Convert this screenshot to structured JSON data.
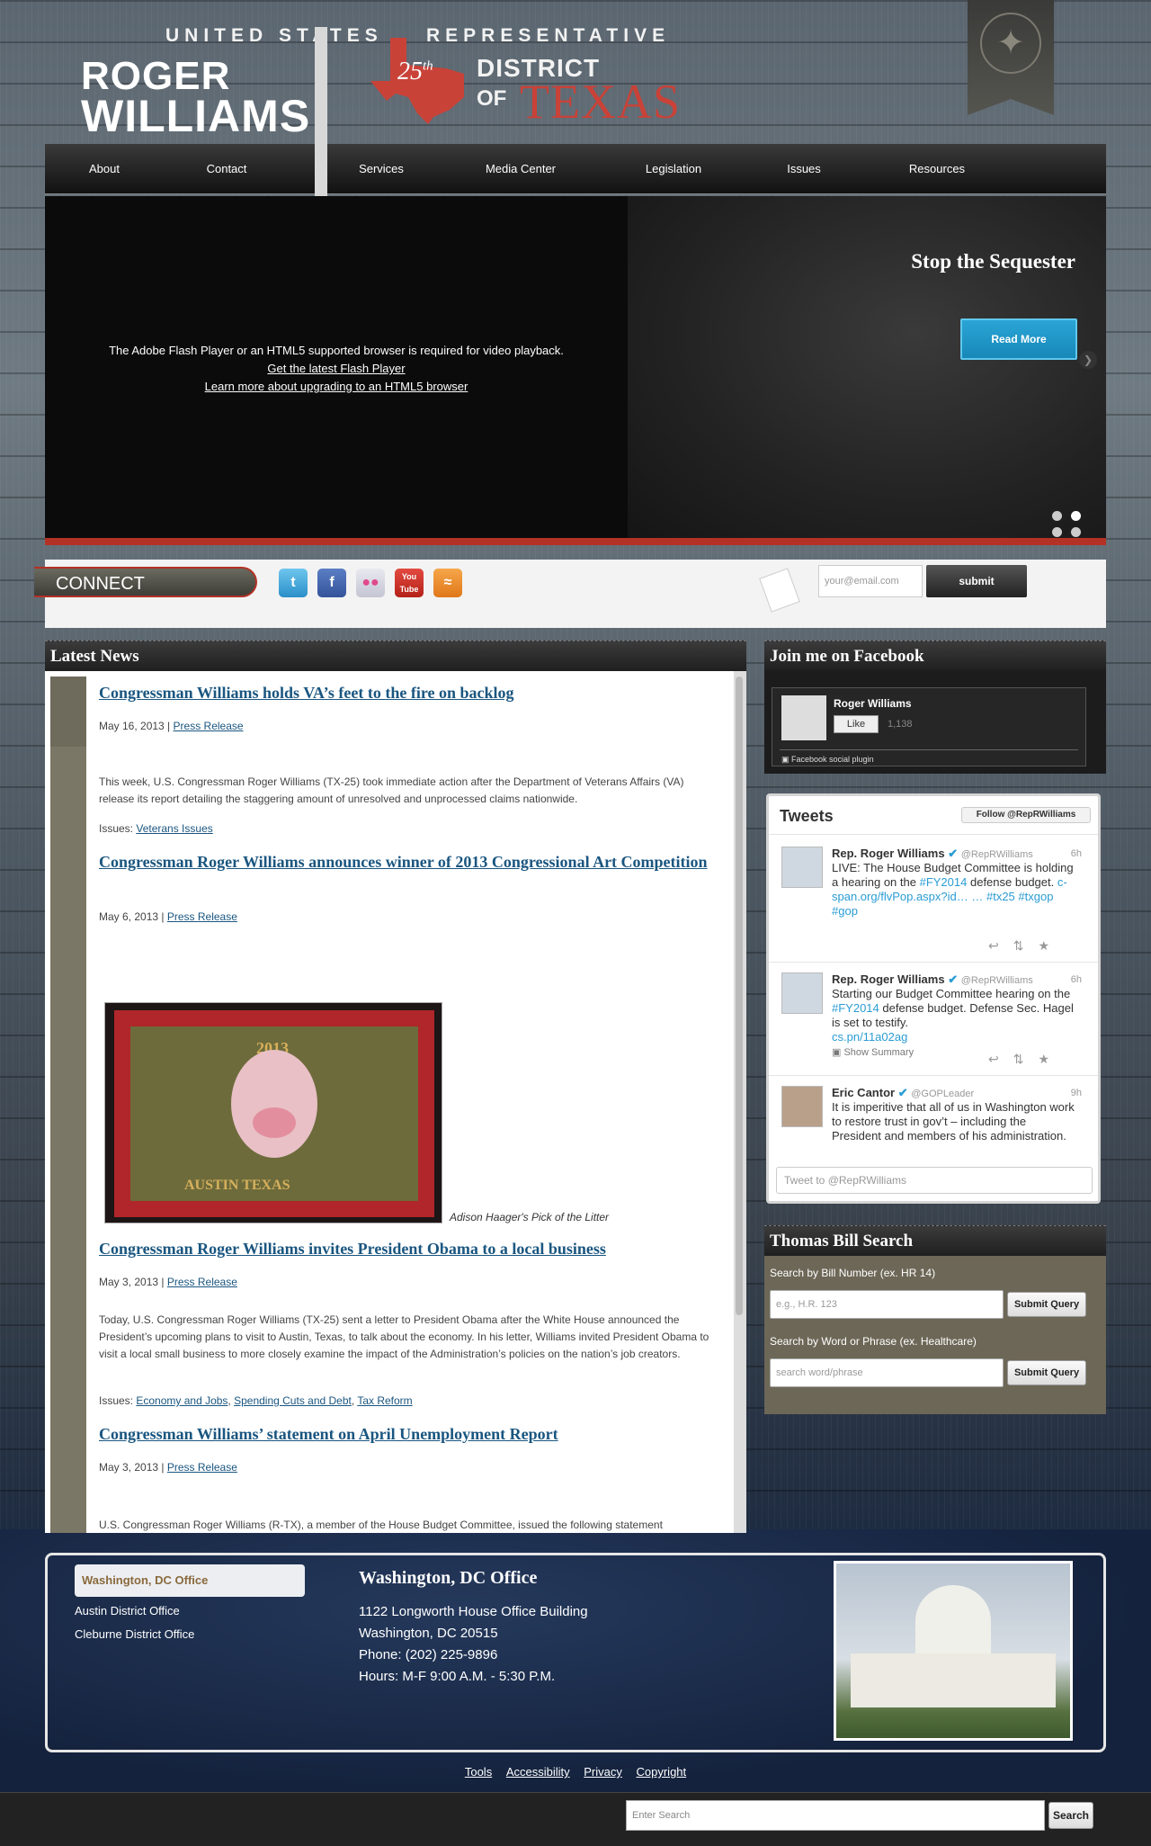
{
  "header": {
    "title_top_left": "UNITED STATES",
    "title_top_right": "REPRESENTATIVE",
    "first_name": "ROGER",
    "last_name": "WILLIAMS",
    "district_number": "25",
    "district_suffix": "th",
    "district_label": "DISTRICT",
    "district_of": "OF",
    "district_state": "TEXAS"
  },
  "nav": {
    "items": [
      "About",
      "Contact",
      "Services",
      "Media Center",
      "Legislation",
      "Issues",
      "Resources"
    ]
  },
  "slider": {
    "flash_message": "The Adobe Flash Player or an HTML5 supported browser is required for video playback.",
    "flash_link1": "Get the latest Flash Player",
    "flash_link2": "Learn more about upgrading to an HTML5 browser",
    "slide_title": "Stop the Sequester",
    "read_more": "Read More"
  },
  "connect": {
    "label": "CONNECT",
    "email_placeholder": "your@email.com",
    "submit": "submit",
    "icons": [
      "twitter-icon",
      "facebook-icon",
      "flickr-icon",
      "youtube-icon",
      "rss-icon"
    ],
    "youtube_text": "You Tube"
  },
  "news": {
    "heading": "Latest News",
    "items": [
      {
        "title": "Congressman Williams holds VA’s feet to the fire on backlog",
        "date": "May 16, 2013 |",
        "category": "Press Release",
        "text": "This week, U.S. Congressman Roger Williams (TX-25) took immediate action after the Department of Veterans Affairs (VA) release its report detailing the staggering amount of unresolved and unprocessed claims nationwide.",
        "issues_label": "Issues:",
        "issues": [
          "Veterans Issues"
        ]
      },
      {
        "title": "Congressman Roger Williams announces winner of 2013 Congressional Art Competition",
        "date": "May 6, 2013 |",
        "category": "Press Release",
        "photo_year": "2013",
        "photo_text": "AUSTIN    TEXAS",
        "caption": "Adison Haager's Pick of the Litter"
      },
      {
        "title": "Congressman Roger Williams invites President Obama to a local business",
        "date": "May 3, 2013 |",
        "category": "Press Release",
        "text": "Today, U.S. Congressman Roger Williams (TX-25) sent a letter to President Obama after the White House announced the President’s upcoming plans to visit to Austin, Texas, to talk about the economy.  In his letter, Williams invited President Obama to visit a local small business to more closely examine the impact of the Administration’s policies on the nation’s job creators.",
        "issues_label": "Issues:",
        "issues": [
          "Economy and Jobs",
          "Spending Cuts and Debt",
          "Tax Reform"
        ]
      },
      {
        "title": "Congressman Williams’ statement on April Unemployment Report",
        "date": "May 3, 2013 |",
        "category": "Press Release",
        "text": "U.S. Congressman Roger Williams (R-TX), a member of the House Budget Committee, issued the following statement"
      }
    ]
  },
  "facebook": {
    "heading": "Join me on Facebook",
    "name": "Roger Williams",
    "like": "Like",
    "count": "1,138",
    "plugin": "Facebook social plugin"
  },
  "twitter": {
    "heading": "Tweets",
    "follow": "Follow @RepRWilliams",
    "tweets": [
      {
        "name": "Rep. Roger Williams",
        "handle": "@RepRWilliams",
        "time": "6h",
        "text": "LIVE: The House Budget Committee is holding a hearing on the",
        "tag1": "#FY2014",
        "text2": "defense budget.",
        "link": "c-span.org/flvPop.aspx?id… … #tx25 #txgop #gop"
      },
      {
        "name": "Rep. Roger Williams",
        "handle": "@RepRWilliams",
        "time": "6h",
        "text": "Starting our Budget Committee hearing on the",
        "tag1": "#FY2014",
        "text2": "defense budget. Defense Sec. Hagel is set to testify.",
        "link": "cs.pn/11a02ag",
        "summary": "Show Summary"
      },
      {
        "name": "Eric Cantor",
        "handle": "@GOPLeader",
        "time": "9h",
        "text": "It is imperitive that all of us in Washington work to restore trust in gov’t – including the President and members of his administration."
      }
    ],
    "tweet_to": "Tweet to @RepRWilliams"
  },
  "bill_search": {
    "heading": "Thomas Bill Search",
    "number_label": "Search by Bill Number (ex. HR 14)",
    "number_placeholder": "e.g., H.R. 123",
    "submit1": "Submit Query",
    "word_label": "Search by Word or Phrase (ex. Healthcare)",
    "word_placeholder": "search word/phrase",
    "submit2": "Submit Query"
  },
  "offices": {
    "tabs": [
      "Washington, DC Office",
      "Austin District Office",
      "Cleburne District Office"
    ],
    "title": "Washington, DC Office",
    "address1": "1122 Longworth House Office Building",
    "address2": "Washington, DC 20515",
    "phone": "Phone: (202) 225-9896",
    "hours": "Hours: M-F 9:00 A.M. - 5:30 P.M."
  },
  "footer": {
    "links": [
      "Tools",
      "Accessibility",
      "Privacy",
      "Copyright"
    ],
    "search_placeholder": "Enter Search",
    "search_button": "Search"
  }
}
